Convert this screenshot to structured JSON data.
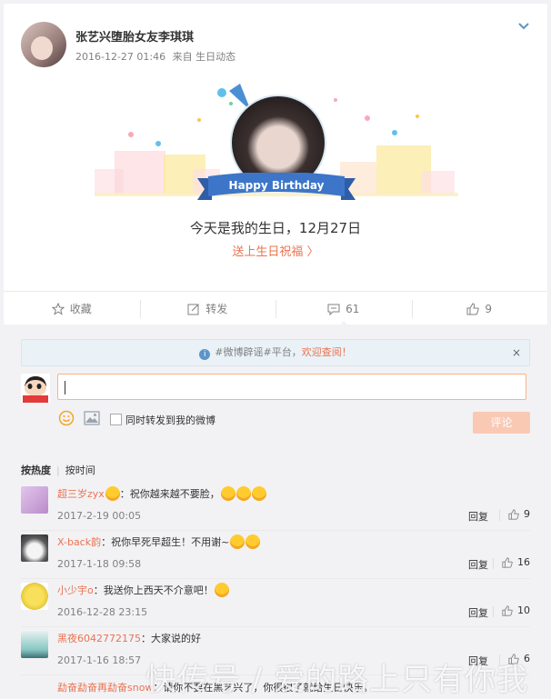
{
  "post": {
    "username": "张艺兴堕胎女友李琪琪",
    "timestamp": "2016-12-27 01:46",
    "source": "来自 生日动态",
    "ribbon": "Happy Birthday",
    "birthday_text": "今天是我的生日，12月27日",
    "bless_link": "送上生日祝福 〉"
  },
  "actions": {
    "favorite": "收藏",
    "forward": "转发",
    "comment_count": "61",
    "like_count": "9"
  },
  "notice": {
    "text_prefix": "#微博辟谣#平台，",
    "link": "欢迎查阅！",
    "close": "×"
  },
  "composer": {
    "forward_option": "同时转发到我的微博",
    "submit": "评论"
  },
  "sort": {
    "hot": "按热度",
    "time": "按时间"
  },
  "comments": [
    {
      "name": "超三岁zyx",
      "text": "：祝你越来越不要脸，",
      "time": "2017-2-19 00:05",
      "reply": "回复",
      "likes": "9",
      "color": "#c9a3d6"
    },
    {
      "name": "X-back韵",
      "text": "：祝你早死早超生！不用谢~",
      "time": "2017-1-18 09:58",
      "reply": "回复",
      "likes": "16",
      "color": "#7c7c7c"
    },
    {
      "name": "小少宇o",
      "text": "：我送你上西天不介意吧！",
      "time": "2016-12-28 23:15",
      "reply": "回复",
      "likes": "10",
      "color": "#f1de5a"
    },
    {
      "name": "黑夜6042772175",
      "text": "：大家说的好",
      "time": "2017-1-16 18:57",
      "reply": "回复",
      "likes": "6",
      "color": "#6fb9b6"
    }
  ],
  "partial_comment": {
    "name": "勐奋勐奋再勐奋snow",
    "text": "：请你不要在黑艺兴了，你很很了就给生日快乐。"
  },
  "watermark": "快传号 / 爱的路上只有你我",
  "colors": {
    "accent": "#eb7350",
    "link_blue": "#5d95c8"
  }
}
